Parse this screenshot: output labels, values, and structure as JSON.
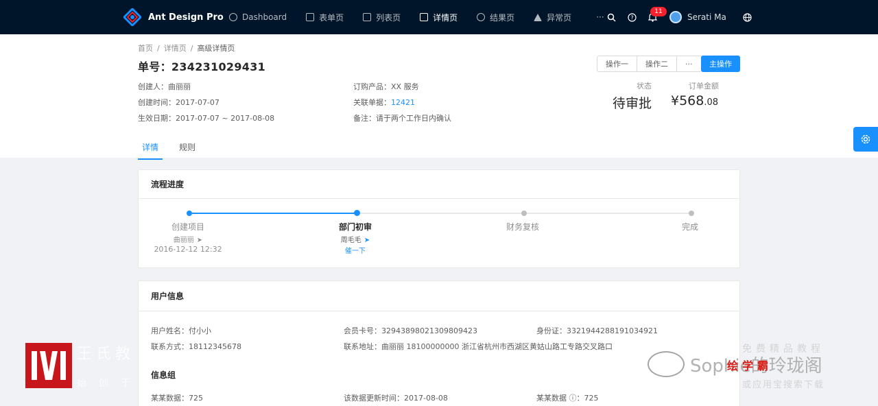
{
  "header": {
    "app_title": "Ant Design Pro",
    "nav": [
      {
        "label": "Dashboard",
        "icon": "dashboard-icon"
      },
      {
        "label": "表单页",
        "icon": "form-icon"
      },
      {
        "label": "列表页",
        "icon": "table-icon"
      },
      {
        "label": "详情页",
        "icon": "profile-icon",
        "active": true
      },
      {
        "label": "结果页",
        "icon": "check-circle-icon"
      },
      {
        "label": "异常页",
        "icon": "warning-icon"
      }
    ],
    "more": "···",
    "notification_count": "11",
    "user_name": "Serati Ma"
  },
  "breadcrumb": [
    "首页",
    "详情页",
    "高级详情页"
  ],
  "order": {
    "title": "单号：234231029431",
    "fields": {
      "creator": "创建人：曲丽丽",
      "created_time": "创建时间：2017-07-07",
      "effective_date": "生效日期：2017-07-07 ~ 2017-08-08",
      "product": "订购产品：XX 服务",
      "related_prefix": "关联单据：",
      "related_value": "12421",
      "note": "备注：请于两个工作日内确认"
    },
    "actions": [
      "操作一",
      "操作二",
      "···"
    ],
    "primary_action": "主操作",
    "status_label": "状态",
    "status_value": "待审批",
    "amount_label": "订单金额",
    "amount_main": "¥568",
    "amount_dec": ".08"
  },
  "tabs": [
    "详情",
    "规则"
  ],
  "progress": {
    "title": "流程进度",
    "steps": [
      {
        "title": "创建项目",
        "person": "曲丽丽",
        "time": "2016-12-12 12:32"
      },
      {
        "title": "部门初审",
        "person": "周毛毛",
        "action": "催一下"
      },
      {
        "title": "财务复核"
      },
      {
        "title": "完成"
      }
    ]
  },
  "user_info": {
    "title": "用户信息",
    "name": "用户姓名：付小小",
    "card": "会员卡号：32943898021309809423",
    "id_card": "身份证：3321944288191034921",
    "phone": "联系方式：18112345678",
    "address": "联系地址：曲丽丽 18100000000 浙江省杭州市西湖区黄姑山路工专路交叉路口",
    "group_title": "信息组",
    "data1": "某某数据：725",
    "data2": "该数据更新时间：2017-08-08",
    "data3": "某某数据 ⓘ：725"
  },
  "watermark": {
    "left_line1": "王氏教",
    "left_line2": "始创于",
    "right_brand": "Sophie的玲珑阁",
    "right_red": "绘学霸",
    "right_top": "免费精品教程",
    "right_bottom": "或应用宝搜索下载"
  },
  "colors": {
    "primary": "#1890ff",
    "header_bg": "#001529",
    "badge": "#f5222d"
  }
}
